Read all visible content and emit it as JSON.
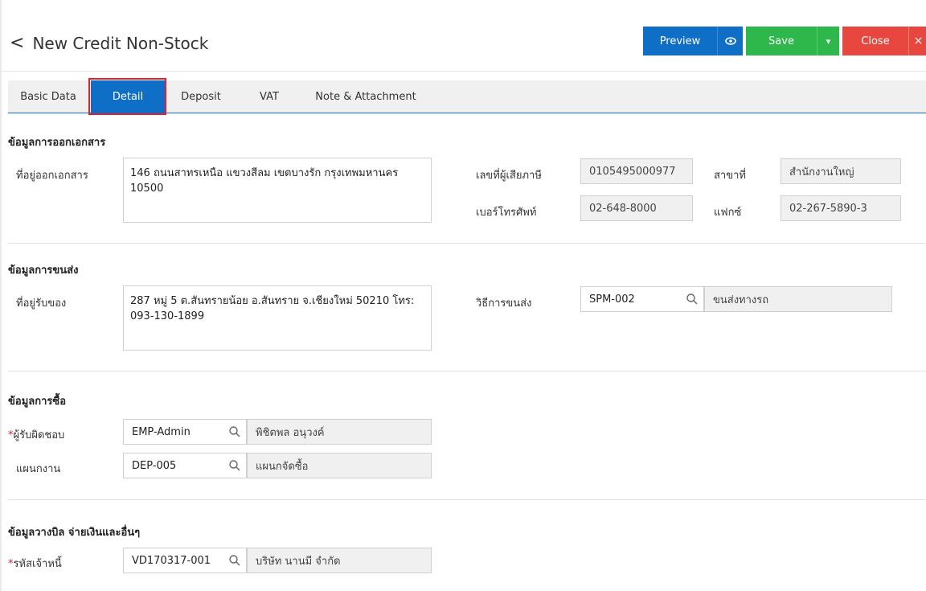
{
  "header": {
    "back_glyph": "<",
    "title": "New Credit Non-Stock",
    "preview_label": "Preview",
    "save_label": "Save",
    "close_label": "Close",
    "close_x": "×",
    "save_caret": "▾"
  },
  "tabs": [
    {
      "label": "Basic Data"
    },
    {
      "label": "Detail"
    },
    {
      "label": "Deposit"
    },
    {
      "label": "VAT"
    },
    {
      "label": "Note & Attachment"
    }
  ],
  "doc_section": {
    "title": "ข้อมูลการออกเอกสาร",
    "address_label": "ที่อยู่ออกเอกสาร",
    "address_value": "146 ถนนสาทรเหนือ แขวงสีลม เขตบางรัก กรุงเทพมหานคร 10500",
    "taxid_label": "เลขที่ผู้เสียภาษี",
    "taxid_value": "0105495000977",
    "branch_label": "สาขาที่",
    "branch_value": "สำนักงานใหญ่",
    "phone_label": "เบอร์โทรศัพท์",
    "phone_value": "02-648-8000",
    "fax_label": "แฟกซ์",
    "fax_value": "02-267-5890-3"
  },
  "ship_section": {
    "title": "ข้อมูลการขนส่ง",
    "address_label": "ที่อยู่รับของ",
    "address_value": "287 หมู่ 5 ต.สันทรายน้อย อ.สันทราย จ.เชียงใหม่ 50210 โทร: 093-130-1899",
    "method_label": "วิธีการขนส่ง",
    "method_code": "SPM-002",
    "method_name": "ขนส่งทางรถ"
  },
  "purchase_section": {
    "title": "ข้อมูลการซื้อ",
    "owner_label": "ผู้รับผิดชอบ",
    "owner_code": "EMP-Admin",
    "owner_name": "พิชิตพล อนุวงค์",
    "dept_label": "แผนกงาน",
    "dept_code": "DEP-005",
    "dept_name": "แผนกจัดซื้อ"
  },
  "billing_section": {
    "title": "ข้อมูลวางบิล จ่ายเงินและอื่นๆ",
    "creditor_label": "รหัสเจ้าหนี้",
    "creditor_code": "VD170317-001",
    "creditor_name": "บริษัท นานมี จำกัด"
  },
  "required_mark": "*",
  "colors": {
    "primary": "#0f6fc6",
    "save": "#2eb84b",
    "close": "#e8473f",
    "highlight": "#e0202a"
  }
}
